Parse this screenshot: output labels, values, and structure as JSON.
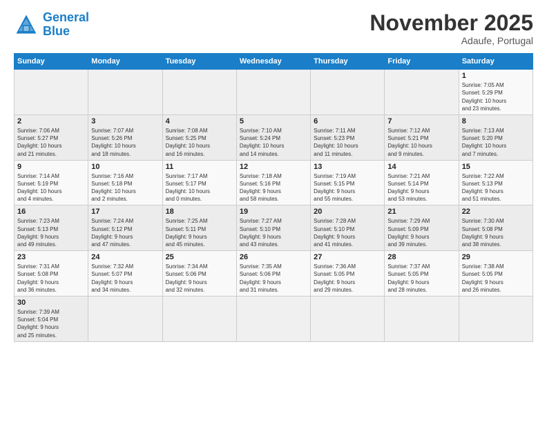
{
  "header": {
    "logo_general": "General",
    "logo_blue": "Blue",
    "month_title": "November 2025",
    "subtitle": "Adaufe, Portugal"
  },
  "weekdays": [
    "Sunday",
    "Monday",
    "Tuesday",
    "Wednesday",
    "Thursday",
    "Friday",
    "Saturday"
  ],
  "weeks": [
    [
      {
        "day": "",
        "info": ""
      },
      {
        "day": "",
        "info": ""
      },
      {
        "day": "",
        "info": ""
      },
      {
        "day": "",
        "info": ""
      },
      {
        "day": "",
        "info": ""
      },
      {
        "day": "",
        "info": ""
      },
      {
        "day": "1",
        "info": "Sunrise: 7:05 AM\nSunset: 5:29 PM\nDaylight: 10 hours\nand 23 minutes."
      }
    ],
    [
      {
        "day": "2",
        "info": "Sunrise: 7:06 AM\nSunset: 5:27 PM\nDaylight: 10 hours\nand 21 minutes."
      },
      {
        "day": "3",
        "info": "Sunrise: 7:07 AM\nSunset: 5:26 PM\nDaylight: 10 hours\nand 18 minutes."
      },
      {
        "day": "4",
        "info": "Sunrise: 7:08 AM\nSunset: 5:25 PM\nDaylight: 10 hours\nand 16 minutes."
      },
      {
        "day": "5",
        "info": "Sunrise: 7:10 AM\nSunset: 5:24 PM\nDaylight: 10 hours\nand 14 minutes."
      },
      {
        "day": "6",
        "info": "Sunrise: 7:11 AM\nSunset: 5:23 PM\nDaylight: 10 hours\nand 11 minutes."
      },
      {
        "day": "7",
        "info": "Sunrise: 7:12 AM\nSunset: 5:21 PM\nDaylight: 10 hours\nand 9 minutes."
      },
      {
        "day": "8",
        "info": "Sunrise: 7:13 AM\nSunset: 5:20 PM\nDaylight: 10 hours\nand 7 minutes."
      }
    ],
    [
      {
        "day": "9",
        "info": "Sunrise: 7:14 AM\nSunset: 5:19 PM\nDaylight: 10 hours\nand 4 minutes."
      },
      {
        "day": "10",
        "info": "Sunrise: 7:16 AM\nSunset: 5:18 PM\nDaylight: 10 hours\nand 2 minutes."
      },
      {
        "day": "11",
        "info": "Sunrise: 7:17 AM\nSunset: 5:17 PM\nDaylight: 10 hours\nand 0 minutes."
      },
      {
        "day": "12",
        "info": "Sunrise: 7:18 AM\nSunset: 5:16 PM\nDaylight: 9 hours\nand 58 minutes."
      },
      {
        "day": "13",
        "info": "Sunrise: 7:19 AM\nSunset: 5:15 PM\nDaylight: 9 hours\nand 55 minutes."
      },
      {
        "day": "14",
        "info": "Sunrise: 7:21 AM\nSunset: 5:14 PM\nDaylight: 9 hours\nand 53 minutes."
      },
      {
        "day": "15",
        "info": "Sunrise: 7:22 AM\nSunset: 5:13 PM\nDaylight: 9 hours\nand 51 minutes."
      }
    ],
    [
      {
        "day": "16",
        "info": "Sunrise: 7:23 AM\nSunset: 5:13 PM\nDaylight: 9 hours\nand 49 minutes."
      },
      {
        "day": "17",
        "info": "Sunrise: 7:24 AM\nSunset: 5:12 PM\nDaylight: 9 hours\nand 47 minutes."
      },
      {
        "day": "18",
        "info": "Sunrise: 7:25 AM\nSunset: 5:11 PM\nDaylight: 9 hours\nand 45 minutes."
      },
      {
        "day": "19",
        "info": "Sunrise: 7:27 AM\nSunset: 5:10 PM\nDaylight: 9 hours\nand 43 minutes."
      },
      {
        "day": "20",
        "info": "Sunrise: 7:28 AM\nSunset: 5:10 PM\nDaylight: 9 hours\nand 41 minutes."
      },
      {
        "day": "21",
        "info": "Sunrise: 7:29 AM\nSunset: 5:09 PM\nDaylight: 9 hours\nand 39 minutes."
      },
      {
        "day": "22",
        "info": "Sunrise: 7:30 AM\nSunset: 5:08 PM\nDaylight: 9 hours\nand 38 minutes."
      }
    ],
    [
      {
        "day": "23",
        "info": "Sunrise: 7:31 AM\nSunset: 5:08 PM\nDaylight: 9 hours\nand 36 minutes."
      },
      {
        "day": "24",
        "info": "Sunrise: 7:32 AM\nSunset: 5:07 PM\nDaylight: 9 hours\nand 34 minutes."
      },
      {
        "day": "25",
        "info": "Sunrise: 7:34 AM\nSunset: 5:06 PM\nDaylight: 9 hours\nand 32 minutes."
      },
      {
        "day": "26",
        "info": "Sunrise: 7:35 AM\nSunset: 5:06 PM\nDaylight: 9 hours\nand 31 minutes."
      },
      {
        "day": "27",
        "info": "Sunrise: 7:36 AM\nSunset: 5:05 PM\nDaylight: 9 hours\nand 29 minutes."
      },
      {
        "day": "28",
        "info": "Sunrise: 7:37 AM\nSunset: 5:05 PM\nDaylight: 9 hours\nand 28 minutes."
      },
      {
        "day": "29",
        "info": "Sunrise: 7:38 AM\nSunset: 5:05 PM\nDaylight: 9 hours\nand 26 minutes."
      }
    ],
    [
      {
        "day": "30",
        "info": "Sunrise: 7:39 AM\nSunset: 5:04 PM\nDaylight: 9 hours\nand 25 minutes."
      },
      {
        "day": "",
        "info": ""
      },
      {
        "day": "",
        "info": ""
      },
      {
        "day": "",
        "info": ""
      },
      {
        "day": "",
        "info": ""
      },
      {
        "day": "",
        "info": ""
      },
      {
        "day": "",
        "info": ""
      }
    ]
  ]
}
